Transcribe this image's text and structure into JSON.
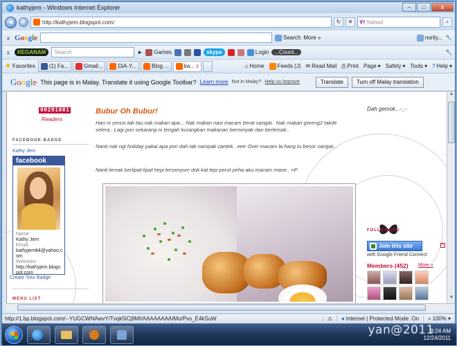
{
  "window": {
    "title": "kathyjem - Windows Internet Explorer",
    "close_label": "x"
  },
  "address": {
    "url": "http://kathyjem.blogspot.com/",
    "search_placeholder": "Yahoo!"
  },
  "google_toolbar": {
    "search_label": "Search",
    "more_label": "More »",
    "user_label": "norliy..."
  },
  "reganam_toolbar": {
    "brand": "REGANAM",
    "search_placeholder": "Search",
    "games_label": "Games",
    "login_label": "Login",
    "count_label": "...Count..."
  },
  "favorites": {
    "label": "Favorites",
    "tabs": [
      {
        "label": "(1) Fa..."
      },
      {
        "label": "Gmail..."
      },
      {
        "label": "DiA-Y..."
      },
      {
        "label": "Blog ..."
      },
      {
        "label": "ka..."
      }
    ],
    "commands": [
      {
        "label": "Home"
      },
      {
        "label": "Feeds (J)"
      },
      {
        "label": "Read Mail"
      },
      {
        "label": "Print"
      },
      {
        "label": "Page"
      },
      {
        "label": "Safety"
      },
      {
        "label": "Tools"
      },
      {
        "label": "Help"
      }
    ]
  },
  "translate_bar": {
    "logo": "Google",
    "message": "This page is in Malay.  Translate it using Google Toolbar?",
    "learn_more": "Learn more",
    "not_malay": "Not in Malay?",
    "help": "Help us improve",
    "translate_button": "Translate",
    "turn_off_button": "Turn off Malay translation"
  },
  "blog": {
    "counter": "00291881",
    "readers": "Readers",
    "facebook_badge_heading": "FACEBOOK BADGE",
    "fb_profile_link": "Kathy Jem",
    "fb_title": "facebook",
    "fb_name_label": "Name:",
    "fb_name": "Kathy Jem",
    "fb_email_label": "Email:",
    "fb_email": "kathyjem84@yahoo.com",
    "fb_website_label": "Websites:",
    "fb_website": "http://kathyjem.blogspot.com",
    "create_badge": "Create Your Badge",
    "menu_list": "MENU LIST",
    "post_title": "Bubur Oh Bubur!",
    "post_para1": "Hari ni serius tak tau nak makan apa... Nak makan nasi macam berat sangat.. Nak makan goreng2 takde selera.. Lagi pon sekarang ni tengah kurangkan makanan berminyak dan berlemak..",
    "post_para2": "Nanti nak ngi holiday pakai apa pon dah tak nampak cantek.. eee Over macam la hang tu besor sangat...",
    "post_para3": "Nanti lemak berlipat-lipat hepi tersenyum dok kat tepi perut peha aku macam mane.. =P",
    "right_text": "Dah gemok...-_-",
    "followers_heading": "FOLLOWERS",
    "join_button": "Join this site",
    "gfc_sub": "with Google Friend Connect",
    "members_label": "Members (452)",
    "more_link": "More »"
  },
  "statusbar": {
    "url": "http://1.bp.blogspot.com/--YUGCWNAwvY/Tvqk5lCj9MI/AAAAAAAAIMo/Pxs_E4kSuW",
    "zone": "Internet | Protected Mode: On",
    "zoom": "100%"
  },
  "taskbar": {
    "time": "9:24 AM",
    "date": "12/24/2011",
    "watermark": "yan@2011"
  },
  "colors": {
    "accent": "#c0103a",
    "title_orange": "#d45a10",
    "facebook_blue": "#3b5998"
  }
}
